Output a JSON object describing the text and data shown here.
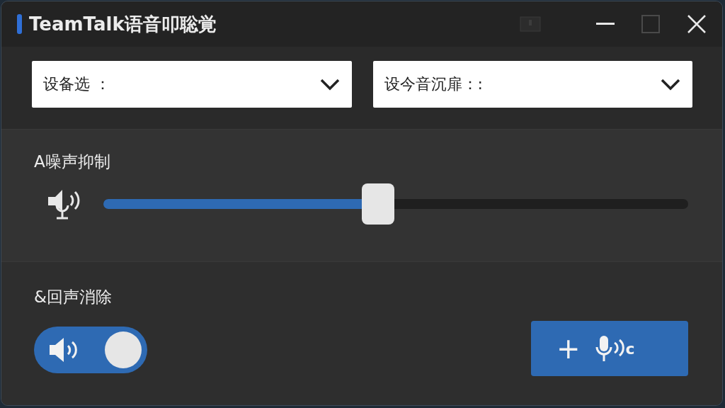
{
  "window": {
    "title": "TeamTalk语音叩聡覚"
  },
  "dropdowns": [
    {
      "label": "设备选 ："
    },
    {
      "label": "设今音沉扉：:"
    }
  ],
  "noise_suppression": {
    "label": "A噪声抑制",
    "level": 0.47
  },
  "echo_cancellation": {
    "label": "&回声消除",
    "on": true
  },
  "action_button": {
    "plus": "+",
    "suffix": "c"
  }
}
